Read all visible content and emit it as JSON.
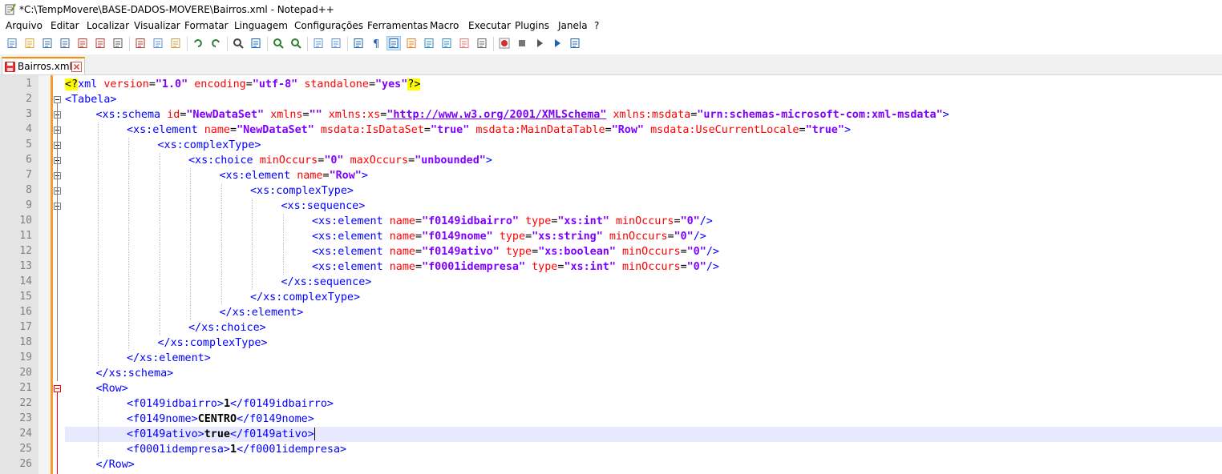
{
  "window": {
    "title": "*C:\\TempMovere\\BASE-DADOS-MOVERE\\Bairros.xml - Notepad++"
  },
  "menu": [
    "Arquivo",
    "Editar",
    "Localizar",
    "Visualizar",
    "Formatar",
    "Linguagem",
    "Configurações",
    "Ferramentas",
    "Macro",
    "Executar",
    "Plugins",
    "Janela",
    "?"
  ],
  "toolbar": {
    "icons": [
      "new-file-icon",
      "open-file-icon",
      "save-icon",
      "save-all-icon",
      "close-icon",
      "close-all-icon",
      "print-icon",
      "cut-icon",
      "copy-icon",
      "paste-icon",
      "undo-icon",
      "redo-icon",
      "find-icon",
      "replace-icon",
      "zoom-in-icon",
      "zoom-out-icon",
      "sync-vertical-icon",
      "sync-horizontal-icon",
      "word-wrap-icon",
      "show-all-chars-icon",
      "indent-guide-icon",
      "user-lang-icon",
      "doc-map-icon",
      "function-list-icon",
      "folder-workspace-icon",
      "monitoring-icon",
      "record-macro-icon",
      "stop-macro-icon",
      "play-macro-icon",
      "run-macro-multiple-icon",
      "save-macro-icon"
    ]
  },
  "tab": {
    "label": "Bairros.xml"
  },
  "colors": {
    "tag": "#0000ff",
    "attribute": "#ff0000",
    "value": "#8000ff",
    "changebar": "#fb9a2c",
    "current_line": "#e8e8ff"
  },
  "editor": {
    "current_line": 24,
    "lines": [
      {
        "n": "1",
        "indent": 0,
        "tokens": [
          [
            "pi",
            "<?"
          ],
          [
            "t",
            "xml "
          ],
          [
            "a",
            "version"
          ],
          [
            "s",
            "="
          ],
          [
            "v",
            "\"1.0\" "
          ],
          [
            "a",
            "encoding"
          ],
          [
            "s",
            "="
          ],
          [
            "v",
            "\"utf-8\" "
          ],
          [
            "a",
            "standalone"
          ],
          [
            "s",
            "="
          ],
          [
            "v",
            "\"yes\""
          ],
          [
            "pi",
            "?>"
          ]
        ]
      },
      {
        "n": "2",
        "indent": 0,
        "tokens": [
          [
            "t",
            "<Tabela>"
          ]
        ]
      },
      {
        "n": "3",
        "indent": 1,
        "tokens": [
          [
            "t",
            "<xs:schema "
          ],
          [
            "a",
            "id"
          ],
          [
            "s",
            "="
          ],
          [
            "v",
            "\"NewDataSet\" "
          ],
          [
            "a",
            "xmlns"
          ],
          [
            "s",
            "="
          ],
          [
            "v",
            "\"\" "
          ],
          [
            "a",
            "xmlns:xs"
          ],
          [
            "s",
            "="
          ],
          [
            "vu",
            "\"http://www.w3.org/2001/XMLSchema\""
          ],
          [
            "v",
            " "
          ],
          [
            "a",
            "xmlns:msdata"
          ],
          [
            "s",
            "="
          ],
          [
            "v",
            "\"urn:schemas-microsoft-com:xml-msdata\""
          ],
          [
            "t",
            ">"
          ]
        ]
      },
      {
        "n": "4",
        "indent": 2,
        "tokens": [
          [
            "t",
            "<xs:element "
          ],
          [
            "a",
            "name"
          ],
          [
            "s",
            "="
          ],
          [
            "v",
            "\"NewDataSet\" "
          ],
          [
            "a",
            "msdata:IsDataSet"
          ],
          [
            "s",
            "="
          ],
          [
            "v",
            "\"true\" "
          ],
          [
            "a",
            "msdata:MainDataTable"
          ],
          [
            "s",
            "="
          ],
          [
            "v",
            "\"Row\" "
          ],
          [
            "a",
            "msdata:UseCurrentLocale"
          ],
          [
            "s",
            "="
          ],
          [
            "v",
            "\"true\""
          ],
          [
            "t",
            ">"
          ]
        ]
      },
      {
        "n": "5",
        "indent": 3,
        "tokens": [
          [
            "t",
            "<xs:complexType>"
          ]
        ]
      },
      {
        "n": "6",
        "indent": 4,
        "tokens": [
          [
            "t",
            "<xs:choice "
          ],
          [
            "a",
            "minOccurs"
          ],
          [
            "s",
            "="
          ],
          [
            "v",
            "\"0\" "
          ],
          [
            "a",
            "maxOccurs"
          ],
          [
            "s",
            "="
          ],
          [
            "v",
            "\"unbounded\""
          ],
          [
            "t",
            ">"
          ]
        ]
      },
      {
        "n": "7",
        "indent": 5,
        "tokens": [
          [
            "t",
            "<xs:element "
          ],
          [
            "a",
            "name"
          ],
          [
            "s",
            "="
          ],
          [
            "v",
            "\"Row\""
          ],
          [
            "t",
            ">"
          ]
        ]
      },
      {
        "n": "8",
        "indent": 6,
        "tokens": [
          [
            "t",
            "<xs:complexType>"
          ]
        ]
      },
      {
        "n": "9",
        "indent": 7,
        "tokens": [
          [
            "t",
            "<xs:sequence>"
          ]
        ]
      },
      {
        "n": "10",
        "indent": 8,
        "tokens": [
          [
            "t",
            "<xs:element "
          ],
          [
            "a",
            "name"
          ],
          [
            "s",
            "="
          ],
          [
            "v",
            "\"f0149idbairro\" "
          ],
          [
            "a",
            "type"
          ],
          [
            "s",
            "="
          ],
          [
            "v",
            "\"xs:int\" "
          ],
          [
            "a",
            "minOccurs"
          ],
          [
            "s",
            "="
          ],
          [
            "v",
            "\"0\""
          ],
          [
            "t",
            "/>"
          ]
        ]
      },
      {
        "n": "11",
        "indent": 8,
        "tokens": [
          [
            "t",
            "<xs:element "
          ],
          [
            "a",
            "name"
          ],
          [
            "s",
            "="
          ],
          [
            "v",
            "\"f0149nome\" "
          ],
          [
            "a",
            "type"
          ],
          [
            "s",
            "="
          ],
          [
            "v",
            "\"xs:string\" "
          ],
          [
            "a",
            "minOccurs"
          ],
          [
            "s",
            "="
          ],
          [
            "v",
            "\"0\""
          ],
          [
            "t",
            "/>"
          ]
        ]
      },
      {
        "n": "12",
        "indent": 8,
        "tokens": [
          [
            "t",
            "<xs:element "
          ],
          [
            "a",
            "name"
          ],
          [
            "s",
            "="
          ],
          [
            "v",
            "\"f0149ativo\" "
          ],
          [
            "a",
            "type"
          ],
          [
            "s",
            "="
          ],
          [
            "v",
            "\"xs:boolean\" "
          ],
          [
            "a",
            "minOccurs"
          ],
          [
            "s",
            "="
          ],
          [
            "v",
            "\"0\""
          ],
          [
            "t",
            "/>"
          ]
        ]
      },
      {
        "n": "13",
        "indent": 8,
        "tokens": [
          [
            "t",
            "<xs:element "
          ],
          [
            "a",
            "name"
          ],
          [
            "s",
            "="
          ],
          [
            "v",
            "\"f0001idempresa\" "
          ],
          [
            "a",
            "type"
          ],
          [
            "s",
            "="
          ],
          [
            "v",
            "\"xs:int\" "
          ],
          [
            "a",
            "minOccurs"
          ],
          [
            "s",
            "="
          ],
          [
            "v",
            "\"0\""
          ],
          [
            "t",
            "/>"
          ]
        ]
      },
      {
        "n": "14",
        "indent": 7,
        "tokens": [
          [
            "t",
            "</xs:sequence>"
          ]
        ]
      },
      {
        "n": "15",
        "indent": 6,
        "tokens": [
          [
            "t",
            "</xs:complexType>"
          ]
        ]
      },
      {
        "n": "16",
        "indent": 5,
        "tokens": [
          [
            "t",
            "</xs:element>"
          ]
        ]
      },
      {
        "n": "17",
        "indent": 4,
        "tokens": [
          [
            "t",
            "</xs:choice>"
          ]
        ]
      },
      {
        "n": "18",
        "indent": 3,
        "tokens": [
          [
            "t",
            "</xs:complexType>"
          ]
        ]
      },
      {
        "n": "19",
        "indent": 2,
        "tokens": [
          [
            "t",
            "</xs:element>"
          ]
        ]
      },
      {
        "n": "20",
        "indent": 1,
        "tokens": [
          [
            "t",
            "</xs:schema>"
          ]
        ]
      },
      {
        "n": "21",
        "indent": 1,
        "tokens": [
          [
            "t",
            "<Row>"
          ]
        ]
      },
      {
        "n": "22",
        "indent": 2,
        "tokens": [
          [
            "t",
            "<f0149idbairro>"
          ],
          [
            "x",
            "1"
          ],
          [
            "t",
            "</f0149idbairro>"
          ]
        ]
      },
      {
        "n": "23",
        "indent": 2,
        "tokens": [
          [
            "t",
            "<f0149nome>"
          ],
          [
            "x",
            "CENTRO"
          ],
          [
            "t",
            "</f0149nome>"
          ]
        ]
      },
      {
        "n": "24",
        "indent": 2,
        "tokens": [
          [
            "t",
            "<f0149ativo>"
          ],
          [
            "x",
            "true"
          ],
          [
            "t",
            "</f0149ativo>"
          ]
        ]
      },
      {
        "n": "25",
        "indent": 2,
        "tokens": [
          [
            "t",
            "<f0001idempresa>"
          ],
          [
            "x",
            "1"
          ],
          [
            "t",
            "</f0001idempresa>"
          ]
        ]
      },
      {
        "n": "26",
        "indent": 1,
        "tokens": [
          [
            "t",
            "</Row>"
          ]
        ]
      }
    ]
  }
}
